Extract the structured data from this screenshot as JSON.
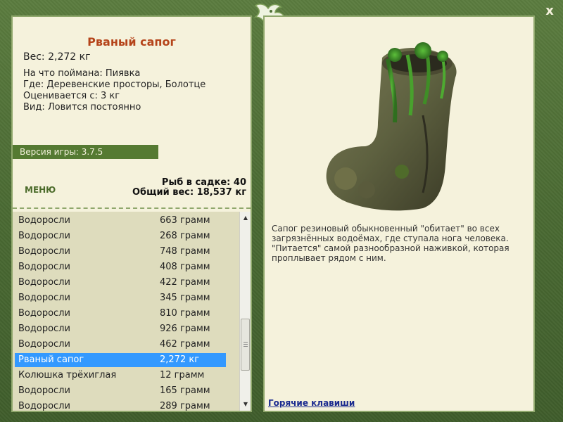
{
  "fish": {
    "title": "Рваный сапог",
    "weight": "Вес: 2,272 кг",
    "caught_on": "На что поймана: Пиявка",
    "where": "Где: Деревенские просторы, Болотце",
    "valued_from": "Оценивается с: 3 кг",
    "kind": "Вид: Ловится постоянно",
    "description": "Сапог резиновый обыкновенный \"обитает\" во всех загрязнённых водоёмах, где ступала нога человека. \"Питается\" самой разнообразной наживкой, которая проплывает рядом с ним."
  },
  "version_label": "Версия игры: 3.7.5",
  "menu_label": "МЕНЮ",
  "cage": {
    "count": "Рыб в садке: 40",
    "total_weight": "Общий вес: 18,537 кг"
  },
  "catch_list": [
    {
      "name": "Водоросли",
      "weight": "663 грамм"
    },
    {
      "name": "Водоросли",
      "weight": "268 грамм"
    },
    {
      "name": "Водоросли",
      "weight": "748 грамм"
    },
    {
      "name": "Водоросли",
      "weight": "408 грамм"
    },
    {
      "name": "Водоросли",
      "weight": "422 грамм"
    },
    {
      "name": "Водоросли",
      "weight": "345 грамм"
    },
    {
      "name": "Водоросли",
      "weight": "810 грамм"
    },
    {
      "name": "Водоросли",
      "weight": "926 грамм"
    },
    {
      "name": "Водоросли",
      "weight": "462 грамм"
    },
    {
      "name": "Рваный сапог",
      "weight": "2,272 кг"
    },
    {
      "name": "Колюшка трёхиглая",
      "weight": "12 грамм"
    },
    {
      "name": "Водоросли",
      "weight": "165 грамм"
    },
    {
      "name": "Водоросли",
      "weight": "289 грамм"
    }
  ],
  "selected_index": 9,
  "hotkeys_label": "Горячие клавиши",
  "close_glyph": "x",
  "icons": {
    "close": "close-icon",
    "emblem": "dragon-emblem-icon",
    "scroll_up": "scroll-up-arrow-icon",
    "scroll_down": "scroll-down-arrow-icon"
  },
  "colors": {
    "frame": "#4f6f36",
    "panel": "#f5f2dc",
    "title": "#b5441a",
    "selection": "#3399ff",
    "list_bg": "#dedcbd",
    "link": "#1a2a8f"
  }
}
